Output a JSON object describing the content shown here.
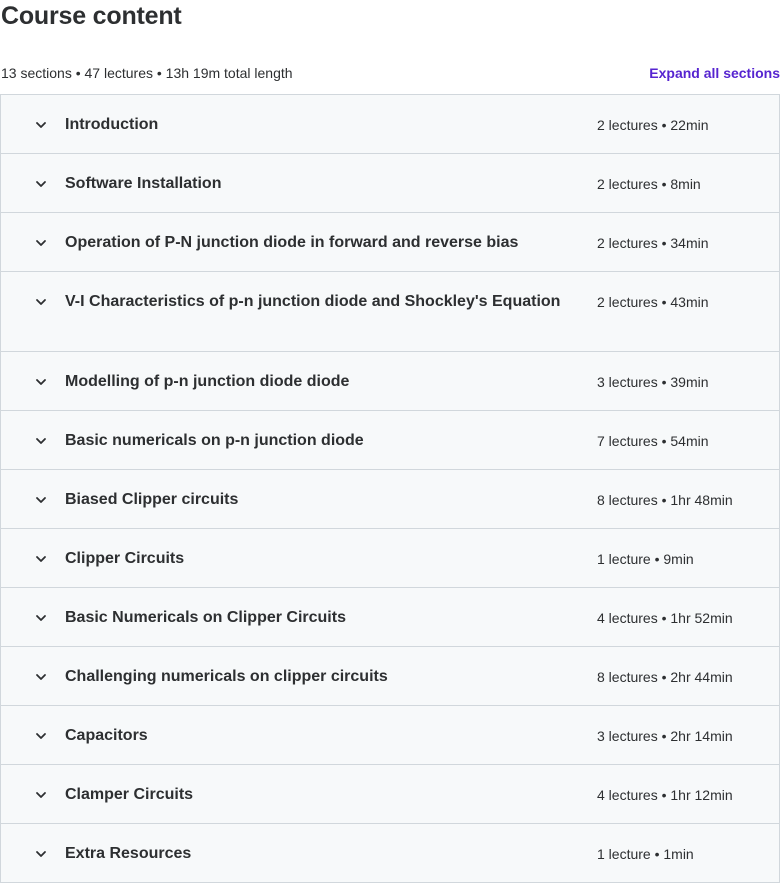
{
  "header": {
    "title": "Course content",
    "summary": "13 sections • 47 lectures • 13h 19m total length",
    "expand_label": "Expand all sections"
  },
  "sections": [
    {
      "title": "Introduction",
      "meta": "2 lectures • 22min"
    },
    {
      "title": "Software Installation",
      "meta": "2 lectures • 8min"
    },
    {
      "title": "Operation of P-N junction diode in forward and reverse bias",
      "meta": "2 lectures • 34min"
    },
    {
      "title": "V-I Characteristics of p-n junction diode and Shockley's Equation",
      "meta": "2 lectures • 43min"
    },
    {
      "title": "Modelling of p-n junction diode diode",
      "meta": "3 lectures • 39min"
    },
    {
      "title": "Basic numericals on p-n junction diode",
      "meta": "7 lectures • 54min"
    },
    {
      "title": "Biased Clipper circuits",
      "meta": "8 lectures • 1hr 48min"
    },
    {
      "title": "Clipper Circuits",
      "meta": "1 lecture • 9min"
    },
    {
      "title": "Basic Numericals on Clipper Circuits",
      "meta": "4 lectures • 1hr 52min"
    },
    {
      "title": "Challenging numericals on clipper circuits",
      "meta": "8 lectures • 2hr 44min"
    },
    {
      "title": "Capacitors",
      "meta": "3 lectures • 2hr 14min"
    },
    {
      "title": "Clamper Circuits",
      "meta": "4 lectures • 1hr 12min"
    },
    {
      "title": "Extra Resources",
      "meta": "1 lecture • 1min"
    }
  ],
  "icons": {
    "section_toggle": "chevron-down-icon"
  },
  "colors": {
    "accent": "#5624d0",
    "text": "#2d2f31",
    "row_bg": "#f7f9fa",
    "border": "#d1d7dc"
  }
}
